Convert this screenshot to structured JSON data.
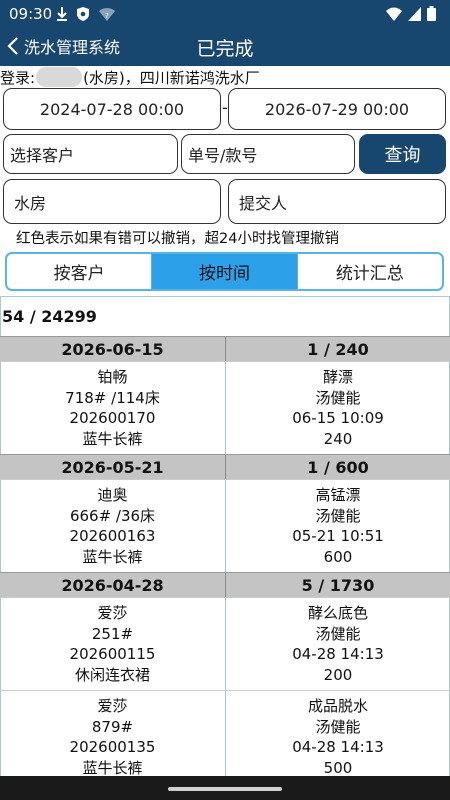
{
  "status_bar": {
    "time": "09:30",
    "left_icons": [
      "download-icon",
      "shield-icon",
      "wifi-question-icon"
    ],
    "right_icons": [
      "wifi-icon",
      "signal-icon",
      "battery-icon"
    ]
  },
  "app_bar": {
    "back_label": "洗水管理系统",
    "title": "已完成",
    "color": "#17466f"
  },
  "login": {
    "prefix": "登录:",
    "suffix": "(水房)，四川新诺鸿洗水厂"
  },
  "filters": {
    "start_date": "2024-07-28 00:00",
    "separator": "-",
    "end_date": "2026-07-29 00:00",
    "customer_placeholder": "选择客户",
    "order_placeholder": "单号/款号",
    "query_label": "查询",
    "department_value": "水房",
    "submitter_placeholder": "提交人"
  },
  "note": "红色表示如果有错可以撤销，超24小时找管理撤销",
  "tabs": [
    {
      "label": "按客户",
      "active": false
    },
    {
      "label": "按时间",
      "active": true
    },
    {
      "label": "统计汇总",
      "active": false
    }
  ],
  "count": "54 / 24299",
  "groups": [
    {
      "date": "2026-06-15",
      "summary": "1 / 240",
      "items": [
        {
          "left": [
            "铂畅",
            "718# /114床",
            "202600170",
            "蓝牛长裤"
          ],
          "right": [
            "酵漂",
            "汤健能",
            "06-15 10:09",
            "240"
          ]
        }
      ]
    },
    {
      "date": "2026-05-21",
      "summary": "1 / 600",
      "items": [
        {
          "left": [
            "迪奥",
            "666# /36床",
            "202600163",
            "蓝牛长裤"
          ],
          "right": [
            "高锰漂",
            "汤健能",
            "05-21 10:51",
            "600"
          ]
        }
      ]
    },
    {
      "date": "2026-04-28",
      "summary": "5 / 1730",
      "items": [
        {
          "left": [
            "爱莎",
            "251#",
            "202600115",
            "休闲连衣裙"
          ],
          "right": [
            "酵么底色",
            "汤健能",
            "04-28 14:13",
            "200"
          ]
        },
        {
          "left": [
            "爱莎",
            "879#",
            "202600135",
            "蓝牛长裤"
          ],
          "right": [
            "成品脱水",
            "汤健能",
            "04-28 14:13",
            "500"
          ]
        }
      ]
    }
  ]
}
